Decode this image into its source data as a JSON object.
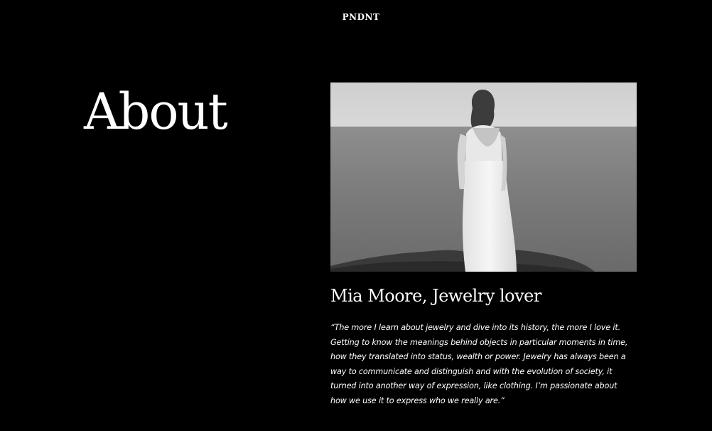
{
  "header": {
    "logo_text": "PNDNT"
  },
  "main": {
    "title": "About",
    "photo": {
      "alt": "Mia Moore, Jewelry lover"
    },
    "person": {
      "name_title": "Mia Moore, Jewelry lover"
    },
    "quote": "“The more I learn about jewelry and dive into its history, the more I love it. Getting to know the meanings behind objects in particular moments in time, how they translated into status, wealth or power. Jewelry has always been a way to communicate and distinguish and with the evolution of society, it turned into another way of expression, like clothing. I’m passionate about how we use it to express who we really are.”"
  },
  "colors": {
    "background": "#000000",
    "text": "#ffffff"
  }
}
